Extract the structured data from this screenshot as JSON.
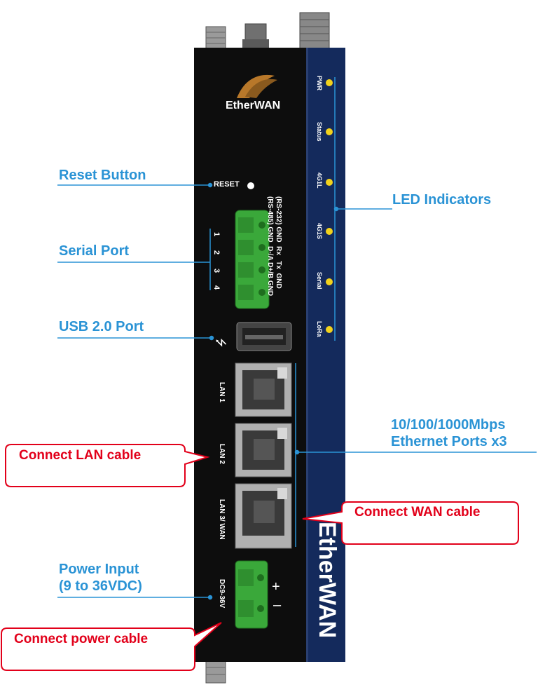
{
  "device": {
    "brand_logo": "EtherWAN",
    "brand_side": "EtherWAN",
    "reset_label": "RESET",
    "serial_header_1": "(RS-232) GND  Rx   Tx  GND",
    "serial_header_2": "(RS-485) GND  D-/A D+/B GND",
    "pin_numbers": [
      "1",
      "2",
      "3",
      "4"
    ],
    "lan_ports": [
      "LAN 1",
      "LAN 2",
      "LAN 3/ WAN"
    ],
    "power_label": "DC9-36V",
    "power_plus": "+",
    "power_minus": "–",
    "leds": [
      "PWR",
      "Status",
      "4G1L",
      "4G1S",
      "Serial",
      "LoRa"
    ],
    "led_color": "#f2d21c",
    "body_color": "#0d0d0d",
    "side_panel_color": "#142a5c",
    "terminal_color": "#3aa83a"
  },
  "labels": {
    "reset": "Reset Button",
    "serial": "Serial Port",
    "usb": "USB 2.0 Port",
    "leds": "LED Indicators",
    "ethernet_1": "10/100/1000Mbps",
    "ethernet_2": "Ethernet Ports x3",
    "power_1": "Power Input",
    "power_2": "(9 to 36VDC)"
  },
  "callouts": {
    "lan": "Connect LAN cable",
    "wan": "Connect WAN cable",
    "power": "Connect power cable"
  },
  "colors": {
    "label": "#2a93d5",
    "callout": "#e2001a"
  }
}
